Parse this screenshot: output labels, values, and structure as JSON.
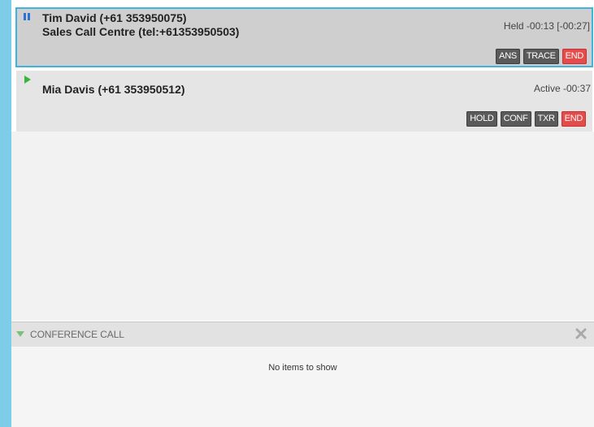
{
  "calls": [
    {
      "caller": "Tim David (+61 353950075)",
      "line2": "Sales Call Centre (tel:+61353950503)",
      "state_icon": "pause-icon",
      "status": "Held -00:13 [-00:27]",
      "buttons": [
        "ANS",
        "TRACE",
        "END"
      ]
    },
    {
      "caller": "Mia Davis (+61 353950512)",
      "state_icon": "play-icon",
      "status": "Active -00:37",
      "buttons": [
        "HOLD",
        "CONF",
        "TXR",
        "END"
      ]
    }
  ],
  "conference": {
    "title": "CONFERENCE CALL",
    "empty_text": "No items to show",
    "collapse_icon": "triangle-down-icon",
    "close_icon": "close-icon"
  },
  "colors": {
    "accent": "#3cb4df",
    "end_button": "#e44b4b",
    "action_button": "#5a5a5a"
  }
}
